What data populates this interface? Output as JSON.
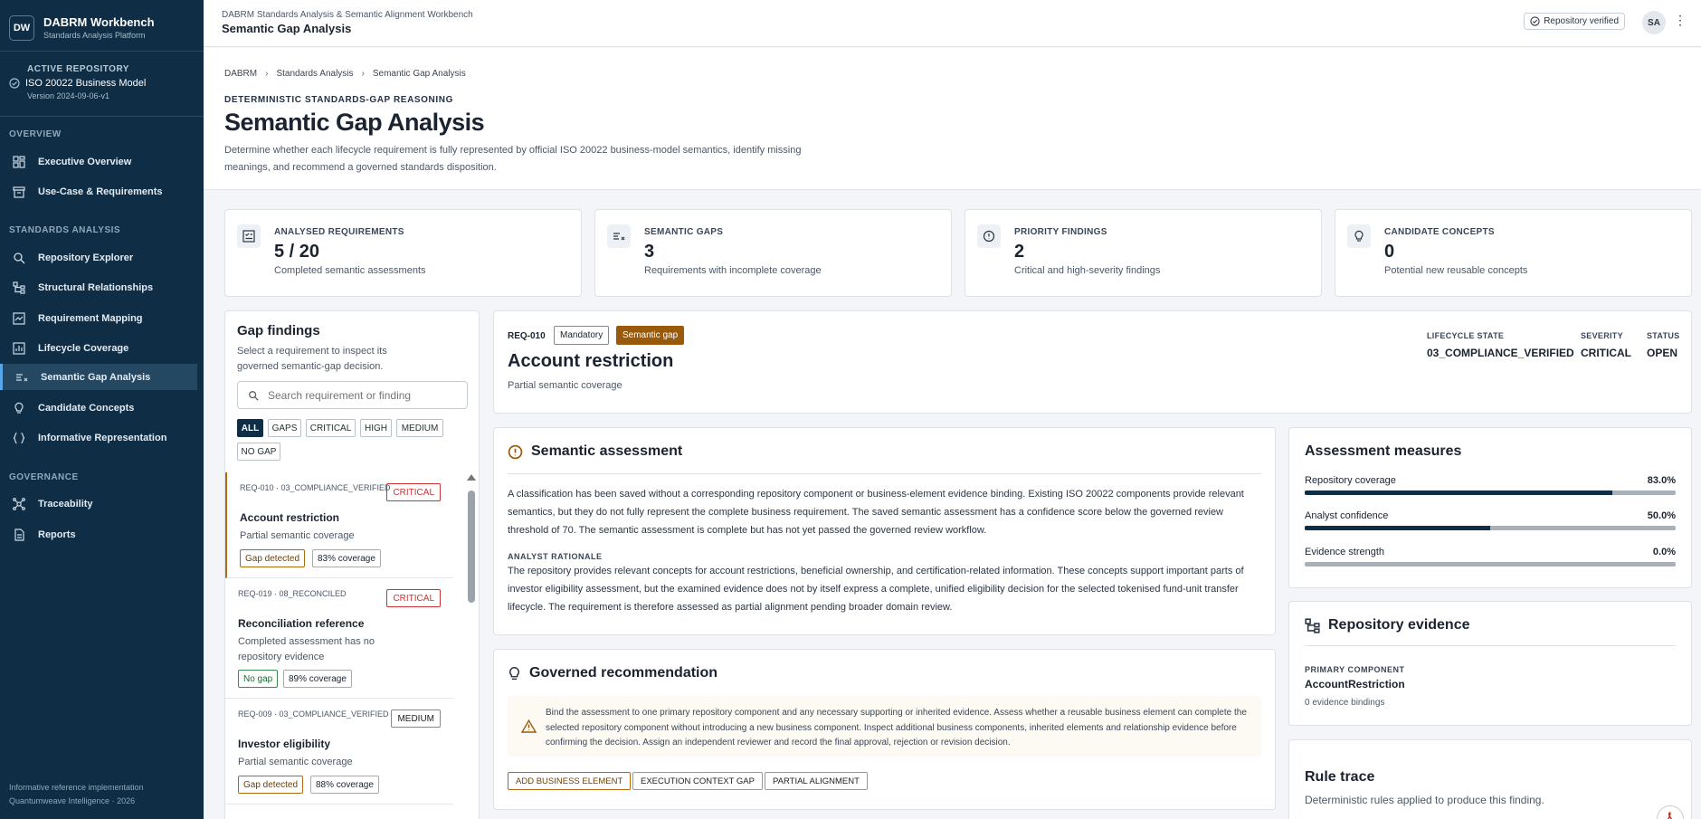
{
  "app": {
    "logo": "DW",
    "title": "DABRM Workbench",
    "subtitle": "Standards Analysis Platform"
  },
  "repository": {
    "heading": "ACTIVE REPOSITORY",
    "name": "ISO 20022 Business Model",
    "version": "Version 2024-09-06-v1"
  },
  "nav": {
    "overview_heading": "OVERVIEW",
    "overview": [
      "Executive Overview",
      "Use-Case & Requirements"
    ],
    "analysis_heading": "STANDARDS ANALYSIS",
    "analysis": [
      "Repository Explorer",
      "Structural Relationships",
      "Requirement Mapping",
      "Lifecycle Coverage",
      "Semantic Gap Analysis",
      "Candidate Concepts",
      "Informative Representation"
    ],
    "governance_heading": "GOVERNANCE",
    "governance": [
      "Traceability",
      "Reports"
    ]
  },
  "footer": {
    "line1": "Informative reference implementation",
    "line2": "Quantumweave Intelligence · 2026"
  },
  "topbar": {
    "subtitle": "DABRM Standards Analysis & Semantic Alignment Workbench",
    "title": "Semantic Gap Analysis",
    "verified": "Repository verified",
    "avatar": "SA"
  },
  "page": {
    "breadcrumbs": [
      "DABRM",
      "Standards Analysis",
      "Semantic Gap Analysis"
    ],
    "eyebrow": "DETERMINISTIC STANDARDS-GAP REASONING",
    "title": "Semantic Gap Analysis",
    "description": "Determine whether each lifecycle requirement is fully represented by official ISO 20022 business-model semantics, identify missing meanings, and recommend a governed standards disposition."
  },
  "kpis": [
    {
      "label": "ANALYSED REQUIREMENTS",
      "value": "5 / 20",
      "sub": "Completed semantic assessments"
    },
    {
      "label": "SEMANTIC GAPS",
      "value": "3",
      "sub": "Requirements with incomplete coverage"
    },
    {
      "label": "PRIORITY FINDINGS",
      "value": "2",
      "sub": "Critical and high-severity findings"
    },
    {
      "label": "CANDIDATE CONCEPTS",
      "value": "0",
      "sub": "Potential new reusable concepts"
    }
  ],
  "findings": {
    "title": "Gap findings",
    "subtitle": "Select a requirement to inspect its governed semantic-gap decision.",
    "search_placeholder": "Search requirement or finding",
    "filters": [
      "ALL",
      "GAPS",
      "CRITICAL",
      "HIGH",
      "MEDIUM",
      "NO GAP"
    ],
    "items": [
      {
        "id": "REQ-010 · 03_COMPLIANCE_VERIFIED",
        "severity": "CRITICAL",
        "title": "Account restriction",
        "sub": "Partial semantic coverage",
        "status": "Gap detected",
        "coverage": "83% coverage"
      },
      {
        "id": "REQ-019 · 08_RECONCILED",
        "severity": "CRITICAL",
        "title": "Reconciliation reference",
        "sub": "Completed assessment has no repository evidence",
        "status": "No gap",
        "coverage": "89% coverage"
      },
      {
        "id": "REQ-009 · 03_COMPLIANCE_VERIFIED",
        "severity": "MEDIUM",
        "title": "Investor eligibility",
        "sub": "Partial semantic coverage",
        "status": "Gap detected",
        "coverage": "88% coverage"
      }
    ]
  },
  "detail": {
    "id": "REQ-010",
    "badge1": "Mandatory",
    "badge2": "Semantic gap",
    "title": "Account restriction",
    "sub": "Partial semantic coverage",
    "meta": [
      {
        "label": "LIFECYCLE STATE",
        "value": "03_COMPLIANCE_VERIFIED"
      },
      {
        "label": "SEVERITY",
        "value": "CRITICAL"
      },
      {
        "label": "STATUS",
        "value": "OPEN"
      }
    ]
  },
  "assessment": {
    "title": "Semantic assessment",
    "text": "A classification has been saved without a corresponding repository component or business-element evidence binding. Existing ISO 20022 components provide relevant semantics, but they do not fully represent the complete business requirement. The saved semantic assessment has a confidence score below the governed review threshold of 70. The semantic assessment is complete but has not yet passed the governed review workflow.",
    "rationale_label": "ANALYST RATIONALE",
    "rationale": "The repository provides relevant concepts for account restrictions, beneficial ownership, and certification-related information. These concepts support important parts of investor eligibility assessment, but the examined evidence does not by itself express a complete, unified eligibility decision for the selected tokenised fund-unit transfer lifecycle. The requirement is therefore assessed as partial alignment pending broader domain review."
  },
  "recommendation": {
    "title": "Governed recommendation",
    "text": "Bind the assessment to one primary repository component and any necessary supporting or inherited evidence. Assess whether a reusable business element can complete the selected repository component without introducing a new business component. Inspect additional business components, inherited elements and relationship evidence before confirming the decision. Assign an independent reviewer and record the final approval, rejection or revision decision.",
    "actions": [
      "ADD BUSINESS ELEMENT",
      "EXECUTION CONTEXT GAP",
      "PARTIAL ALIGNMENT"
    ]
  },
  "measures": {
    "title": "Assessment measures",
    "rows": [
      {
        "label": "Repository coverage",
        "value": "83.0%",
        "fraction": 0.83
      },
      {
        "label": "Analyst confidence",
        "value": "50.0%",
        "fraction": 0.5
      },
      {
        "label": "Evidence strength",
        "value": "0.0%",
        "fraction": 0.0
      }
    ]
  },
  "evidence": {
    "title": "Repository evidence",
    "label": "PRIMARY COMPONENT",
    "component": "AccountRestriction",
    "bindings": "0 evidence bindings"
  },
  "ruletrace": {
    "title": "Rule trace",
    "sub": "Deterministic rules applied to produce this finding."
  },
  "colors": {
    "sidebar": "#0f2d45",
    "accent": "#58a6e8",
    "gap": "#9a5a0c",
    "critical": "#cc3333",
    "ok": "#3a8c4e"
  }
}
